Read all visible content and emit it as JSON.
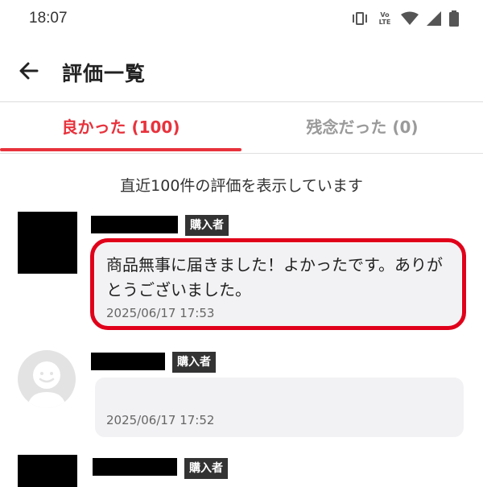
{
  "status_bar": {
    "time": "18:07",
    "icons": [
      "vibrate-icon",
      "volte-icon",
      "wifi-icon",
      "signal-icon",
      "battery-icon"
    ],
    "volte_label_top": "Vo",
    "volte_label_bottom": "LTE"
  },
  "app_bar": {
    "title": "評価一覧"
  },
  "tabs": [
    {
      "label": "良かった (100)",
      "active": true
    },
    {
      "label": "残念だった (0)",
      "active": false
    }
  ],
  "info_text": "直近100件の評価を表示しています",
  "reviews": [
    {
      "badge": "購入者",
      "comment": "商品無事に届きました！よかったです。ありがとうございました。",
      "date": "2025/06/17 17:53",
      "highlighted": true,
      "avatar": "redacted"
    },
    {
      "badge": "購入者",
      "comment": "",
      "date": "2025/06/17 17:52",
      "highlighted": false,
      "avatar": "default-user-icon"
    },
    {
      "badge": "購入者",
      "comment": "",
      "date": "",
      "highlighted": false,
      "avatar": "redacted"
    }
  ],
  "colors": {
    "accent": "#e8323c",
    "highlight_border": "#e0001a",
    "badge_bg": "#333333",
    "bubble_bg": "#f2f2f4"
  }
}
